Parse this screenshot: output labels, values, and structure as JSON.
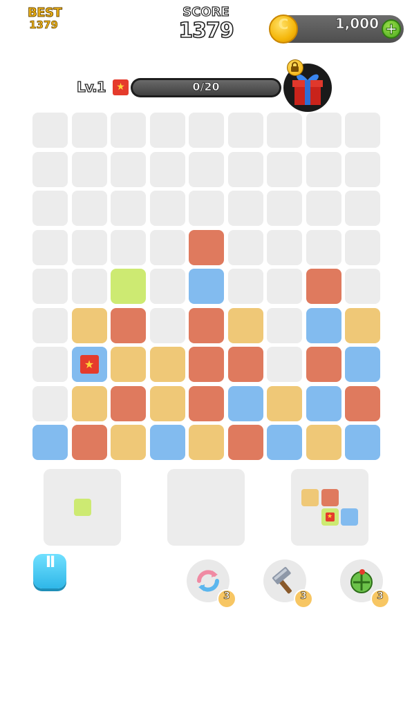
{
  "header": {
    "best_label": "BEST",
    "best_value": "1379",
    "score_label": "SCORE",
    "score_value": "1379",
    "coins": "1,000",
    "add_coins_symbol": "+",
    "coin_symbol": "C"
  },
  "level": {
    "label": "Lv.1",
    "progress_text": "0/20",
    "progress_fraction": 0.0,
    "reward_icon": "gift-box-icon",
    "reward_locked": true
  },
  "colors": {
    "empty": "#ececec",
    "O": "#df7a5e",
    "Y": "#efc877",
    "B": "#82bbef",
    "G": "#cdea72",
    "star_bg": "#e53b2c",
    "star": "#ffd43a"
  },
  "board": {
    "cols": 9,
    "rows": 9,
    "grid": [
      ".........",
      ".........",
      ".........",
      "....O....",
      "..G.B..O.",
      ".YO.OY.BY",
      ".BYYOO.OB",
      ".YOYOBYBO",
      "BOYBYOBYB"
    ],
    "star_cells": [
      [
        6,
        1
      ]
    ]
  },
  "trays": [
    {
      "cells": [
        [
          0,
          0,
          "G"
        ]
      ],
      "star_cells": []
    },
    {
      "cells": [],
      "star_cells": []
    },
    {
      "cells": [
        [
          0,
          0,
          "Y"
        ],
        [
          0,
          1,
          "O"
        ],
        [
          1,
          1,
          "G"
        ],
        [
          1,
          2,
          "B"
        ]
      ],
      "star_cells": [
        [
          1,
          1
        ]
      ]
    }
  ],
  "controls": {
    "pause_symbol": "II",
    "tools": [
      {
        "name": "refresh-icon",
        "count": "3"
      },
      {
        "name": "hammer-icon",
        "count": "3"
      },
      {
        "name": "bomb-icon",
        "count": "3"
      }
    ]
  }
}
